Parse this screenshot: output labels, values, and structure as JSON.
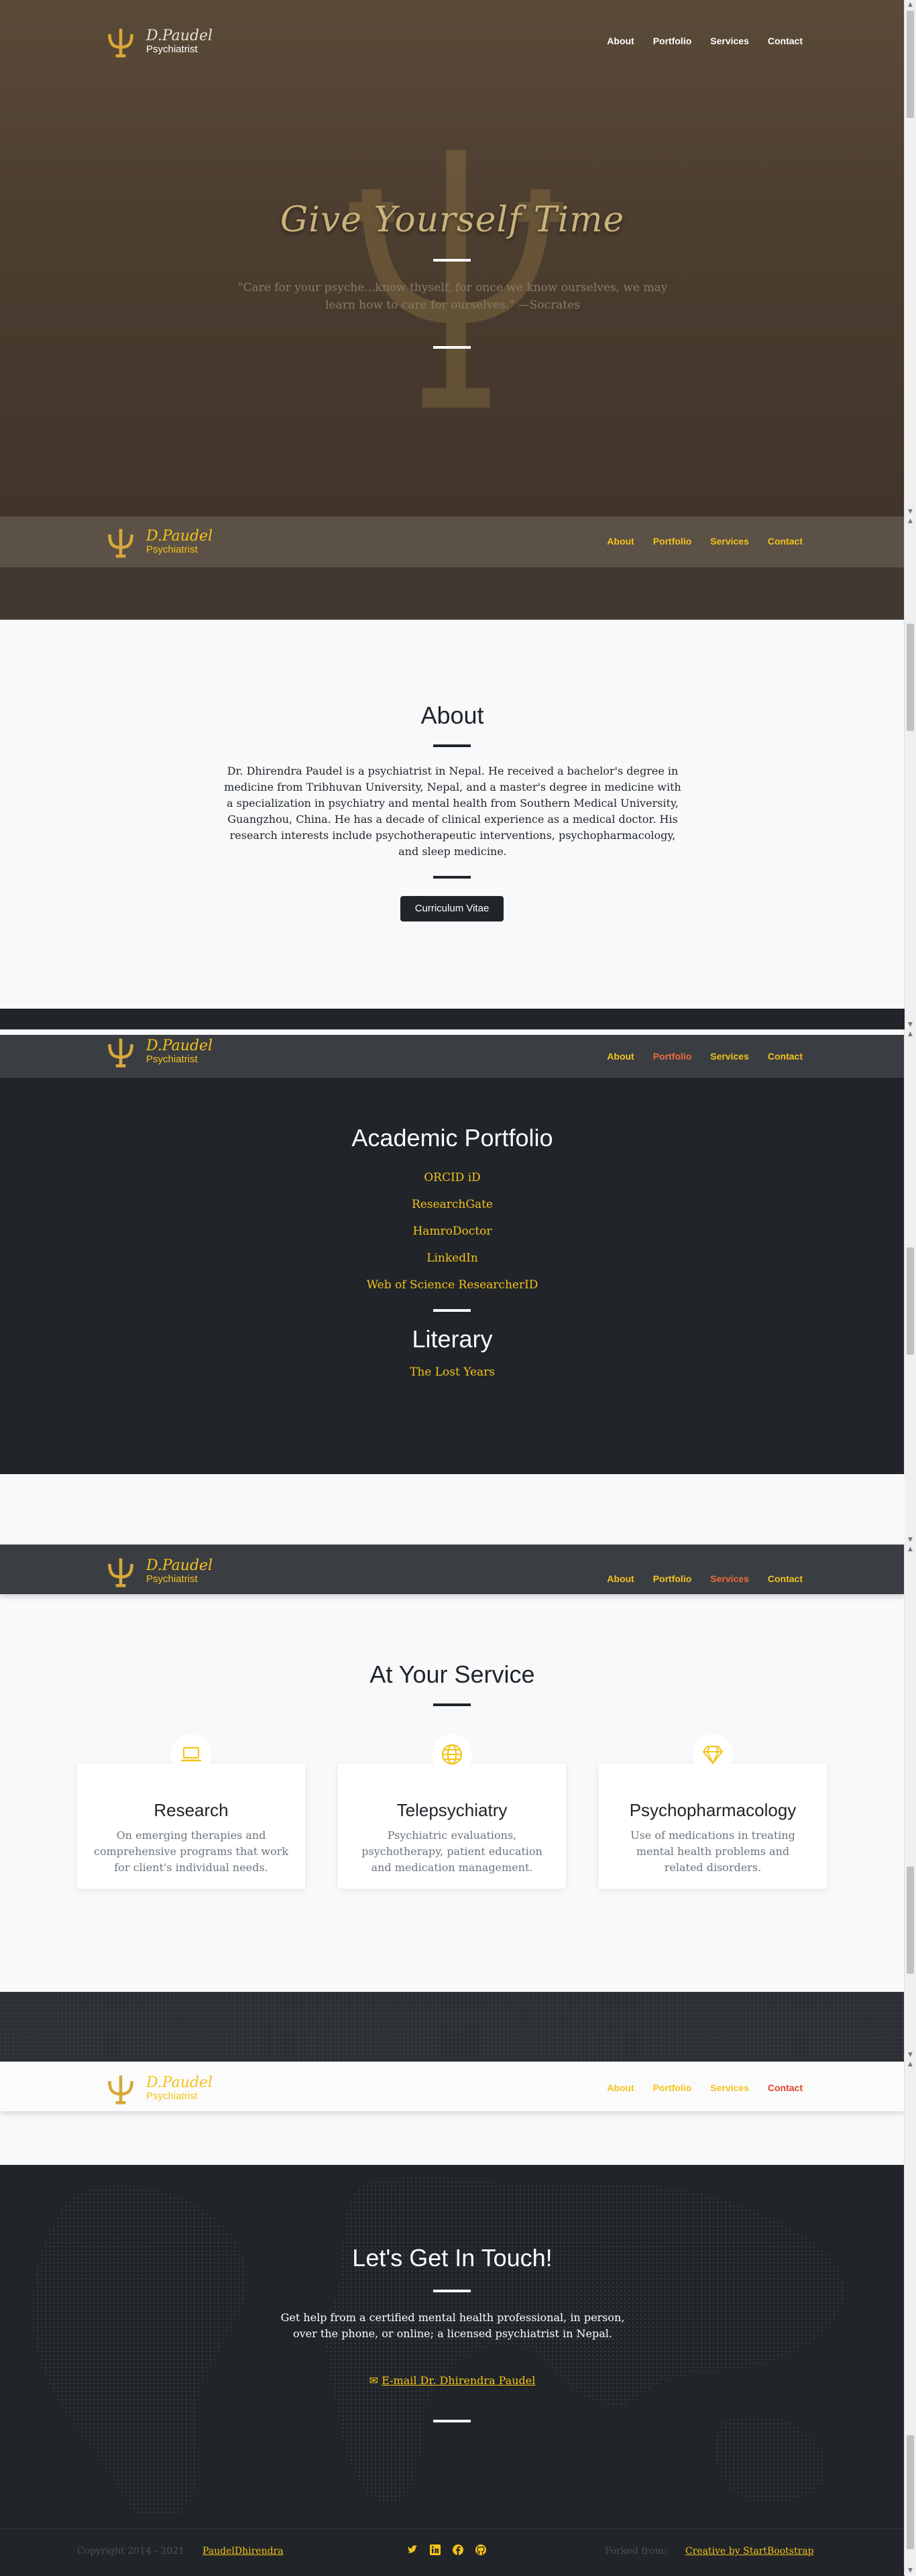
{
  "brand": {
    "name": "D.Paudel",
    "subtitle": "Psychiatrist"
  },
  "nav": {
    "about": "About",
    "portfolio": "Portfolio",
    "services": "Services",
    "contact": "Contact"
  },
  "hero": {
    "title": "Give Yourself Time",
    "quote": "\"Care for your psyche...know thyself, for once we know ourselves, we may learn how to care for ourselves.\" —Socrates"
  },
  "about": {
    "title": "About",
    "text": "Dr. Dhirendra Paudel is a psychiatrist in Nepal. He received a bachelor's degree in medicine from Tribhuvan University, Nepal, and a master's degree in medicine with a specialization in psychiatry and mental health from Southern Medical University, Guangzhou, China. He has a decade of clinical experience as a medical doctor. His research interests include psychotherapeutic interventions, psychopharmacology, and sleep medicine.",
    "cv_button": "Curriculum Vitae"
  },
  "portfolio": {
    "title": "Academic Portfolio",
    "links": [
      "ORCID iD",
      "ResearchGate",
      "HamroDoctor",
      "LinkedIn",
      "Web of Science ResearcherID"
    ],
    "literary_title": "Literary",
    "literary_links": [
      "The Lost Years"
    ]
  },
  "services": {
    "title": "At Your Service",
    "cards": [
      {
        "title": "Research",
        "text": "On emerging therapies and comprehensive programs that work for client's individual needs.",
        "icon": "laptop-icon"
      },
      {
        "title": "Telepsychiatry",
        "text": "Psychiatric evaluations, psychotherapy, patient education and medication management.",
        "icon": "globe-icon"
      },
      {
        "title": "Psychopharmacology",
        "text": "Use of medications in treating mental health problems and related disorders.",
        "icon": "gem-icon"
      }
    ]
  },
  "contact": {
    "title": "Let's Get In Touch!",
    "text": "Get help from a certified mental health professional, in person, over the phone, or online; a licensed psychiatrist in Nepal.",
    "email_link": "E-mail Dr. Dhirendra Paudel"
  },
  "footer": {
    "copyright": "Copyright 2014 - 2021",
    "owner_link": "PaudelDhirendra",
    "forked_label": "Forked from:",
    "forked_link": "Creative by StartBootstrap",
    "social_icons": [
      "twitter-icon",
      "linkedin-icon",
      "facebook-icon",
      "github-icon"
    ]
  },
  "colors": {
    "accent": "#f4c21a",
    "active": "#f26b3a",
    "dark": "#212529",
    "hero": "#4b3d2f"
  }
}
